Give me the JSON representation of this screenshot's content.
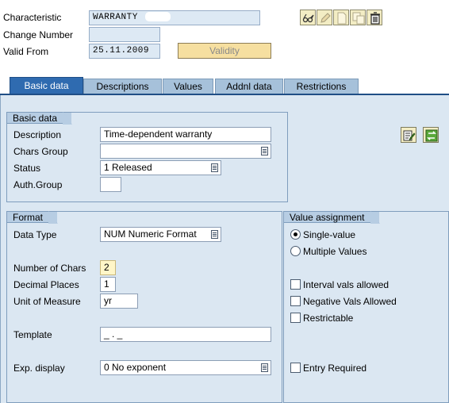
{
  "header": {
    "characteristic_label": "Characteristic",
    "characteristic_value": "WARRANTY",
    "change_number_label": "Change Number",
    "change_number_value": "",
    "valid_from_label": "Valid From",
    "valid_from_value": "25.11.2009",
    "validity_button": "Validity"
  },
  "toolbar": {
    "icons": [
      "display-change-icon",
      "edit-icon",
      "create-icon",
      "copy-icon",
      "delete-icon"
    ]
  },
  "tabs": [
    {
      "label": "Basic data",
      "active": true
    },
    {
      "label": "Descriptions",
      "active": false
    },
    {
      "label": "Values",
      "active": false
    },
    {
      "label": "Addnl data",
      "active": false
    },
    {
      "label": "Restrictions",
      "active": false
    }
  ],
  "basic_data": {
    "title": "Basic data",
    "description_label": "Description",
    "description_value": "Time-dependent warranty",
    "chars_group_label": "Chars Group",
    "chars_group_value": "",
    "status_label": "Status",
    "status_value": "1 Released",
    "auth_group_label": "Auth.Group",
    "auth_group_value": ""
  },
  "format": {
    "title": "Format",
    "data_type_label": "Data Type",
    "data_type_value": "NUM Numeric Format",
    "num_chars_label": "Number of Chars",
    "num_chars_value": "2",
    "decimal_places_label": "Decimal Places",
    "decimal_places_value": "1",
    "unit_label": "Unit of Measure",
    "unit_value": "yr",
    "template_label": "Template",
    "template_value": "_ . _",
    "exp_display_label": "Exp. display",
    "exp_display_value": "0 No exponent"
  },
  "value_assignment": {
    "title": "Value assignment",
    "single_value_label": "Single-value",
    "single_value_selected": true,
    "multiple_values_label": "Multiple Values",
    "interval_label": "Interval vals allowed",
    "negative_label": "Negative Vals Allowed",
    "restrictable_label": "Restrictable",
    "entry_required_label": "Entry Required"
  },
  "colors": {
    "tab_active": "#2f6bb0",
    "tab_inactive": "#a6c1da",
    "panel_bg": "#dbe7f2",
    "button_bg": "#f6dfa0"
  }
}
